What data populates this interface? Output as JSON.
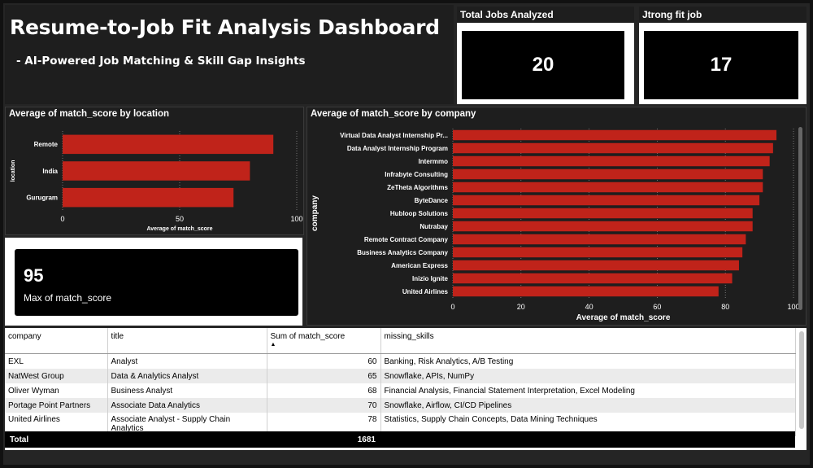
{
  "header": {
    "title": "Resume-to-Job Fit Analysis Dashboard",
    "subtitle": "- AI-Powered Job Matching & Skill Gap Insights"
  },
  "kpis": {
    "total_jobs": {
      "label": "Total Jobs Analyzed",
      "value": "20"
    },
    "strong_fit": {
      "label": "Jtrong fit job",
      "value": "17"
    },
    "max_score": {
      "value": "95",
      "label": "Max of match_score"
    }
  },
  "chart_data": [
    {
      "type": "bar",
      "orientation": "horizontal",
      "title": "Average of match_score by location",
      "xlabel": "Average of match_score",
      "ylabel": "location",
      "categories": [
        "Remote",
        "India",
        "Gurugram"
      ],
      "values": [
        90,
        80,
        73
      ],
      "xlim": [
        0,
        100
      ],
      "xticks": [
        "0",
        "50",
        "100"
      ],
      "color": "#c0231a",
      "grid": true
    },
    {
      "type": "bar",
      "orientation": "horizontal",
      "title": "Average of match_score by company",
      "xlabel": "Average of match_score",
      "ylabel": "company",
      "categories": [
        "Virtual Data Analyst Internship Pr...",
        "Data Analyst Internship Program",
        "Intermmo",
        "Infrabyte Consulting",
        "ZeTheta Algorithms",
        "ByteDance",
        "Hubloop Solutions",
        "Nutrabay",
        "Remote Contract Company",
        "Business Analytics Company",
        "American Express",
        "Inizio Ignite",
        "United Airlines"
      ],
      "values": [
        95,
        94,
        93,
        91,
        91,
        90,
        88,
        88,
        86,
        85,
        84,
        82,
        78
      ],
      "xlim": [
        0,
        100
      ],
      "xticks": [
        "0",
        "20",
        "40",
        "60",
        "80",
        "100"
      ],
      "color": "#c0231a",
      "grid": true
    }
  ],
  "table": {
    "columns": [
      "company",
      "title",
      "Sum of match_score",
      "missing_skills"
    ],
    "rows": [
      [
        "EXL",
        "Analyst",
        "60",
        "Banking, Risk Analytics, A/B Testing"
      ],
      [
        "NatWest Group",
        "Data & Analytics Analyst",
        "65",
        "Snowflake, APIs, NumPy"
      ],
      [
        "Oliver Wyman",
        "Business Analyst",
        "68",
        "Financial Analysis, Financial Statement Interpretation, Excel Modeling"
      ],
      [
        "Portage Point Partners",
        "Associate Data Analytics",
        "70",
        "Snowflake, Airflow, CI/CD Pipelines"
      ],
      [
        "United Airlines",
        "Associate Analyst - Supply Chain Analytics",
        "78",
        "Statistics, Supply Chain Concepts, Data Mining Techniques"
      ]
    ],
    "total_label": "Total",
    "total_value": "1681"
  }
}
